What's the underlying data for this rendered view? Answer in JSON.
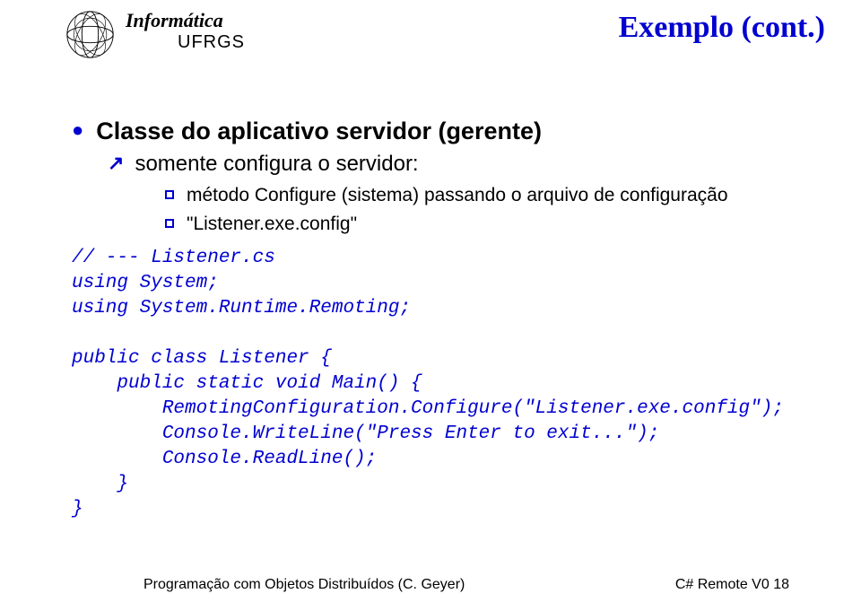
{
  "header": {
    "brand_top": "Informática",
    "brand_sub": "UFRGS",
    "title": "Exemplo (cont.)"
  },
  "bullets": {
    "l1": "Classe do aplicativo servidor (gerente)",
    "l2": "somente configura o servidor:",
    "l3a": "método Configure (sistema) passando o arquivo de configuração",
    "l3b": "\"Listener.exe.config\""
  },
  "code": "// --- Listener.cs\nusing System;\nusing System.Runtime.Remoting;\n\npublic class Listener {\n    public static void Main() {\n        RemotingConfiguration.Configure(\"Listener.exe.config\");\n        Console.WriteLine(\"Press Enter to exit...\");\n        Console.ReadLine();\n    }\n}",
  "footer": {
    "left": "Programação com Objetos Distribuídos (C. Geyer)",
    "right": "C# Remote V0 18"
  }
}
